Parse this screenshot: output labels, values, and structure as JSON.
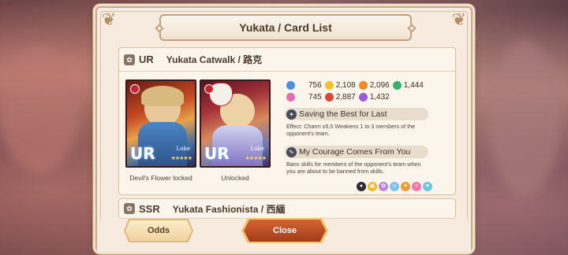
{
  "dialog": {
    "title": "Yukata / Card List"
  },
  "entries": [
    {
      "rarity": "UR",
      "name": "Yukata Catwalk / 路克",
      "cards": [
        {
          "badge": "UR",
          "nameplate": "Luke",
          "caption": "Devil's Flower locked"
        },
        {
          "badge": "UR",
          "nameplate": "Luke",
          "caption": "Unlocked"
        }
      ],
      "stats": {
        "row1": [
          {
            "icon": "blue-gem-icon",
            "color": "#4a90e2",
            "value": "756"
          },
          {
            "icon": "yellow-gem-icon",
            "color": "#f2c12e",
            "value": "2,108"
          },
          {
            "icon": "orange-gem-icon",
            "color": "#f08a2b",
            "value": "2,096"
          },
          {
            "icon": "green-gem-icon",
            "color": "#33b36b",
            "value": "1,444"
          }
        ],
        "row2": [
          {
            "icon": "pink-gem-icon",
            "color": "#e86ab0",
            "value": "745"
          },
          {
            "icon": "red-gem-icon",
            "color": "#e0453a",
            "value": "2,887"
          },
          {
            "icon": "purple-gem-icon",
            "color": "#9a5bd6",
            "value": "1,432"
          }
        ]
      },
      "skills": [
        {
          "name": "Saving the Best for Last",
          "description": "Effect: Charm x5.5 Weakens 1 to 3 members of the opponent's team."
        },
        {
          "name": "My Courage Comes From You",
          "description": "Bans skills for members of the opponent's team when you are about to be banned from skills."
        }
      ],
      "tag_icons": [
        {
          "icon": "cat-icon",
          "color": "#2e2a3a"
        },
        {
          "icon": "gift-icon",
          "color": "#f1b928"
        },
        {
          "icon": "flower-icon",
          "color": "#b986e0"
        },
        {
          "icon": "face-icon",
          "color": "#7cc4ee"
        },
        {
          "icon": "sparkle-icon",
          "color": "#f09a3a"
        },
        {
          "icon": "wand-icon",
          "color": "#f07ab0"
        },
        {
          "icon": "heart-icon",
          "color": "#6cc7d8"
        }
      ]
    },
    {
      "rarity": "SSR",
      "name": "Yukata Fashionista / 西緬"
    }
  ],
  "buttons": {
    "odds": "Odds",
    "close": "Close"
  }
}
